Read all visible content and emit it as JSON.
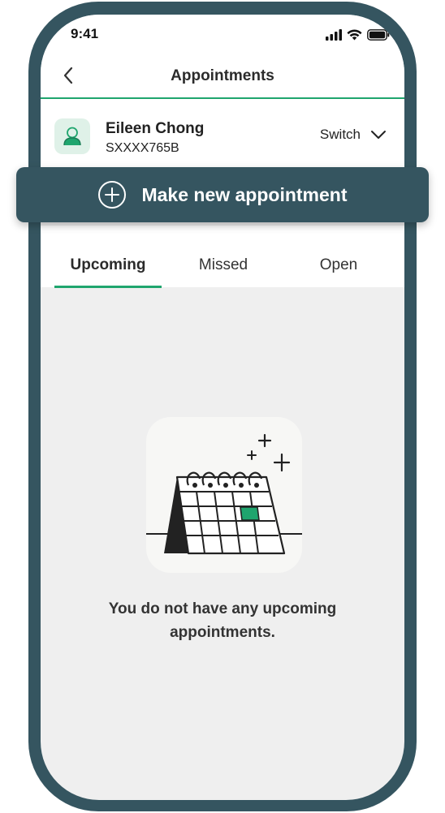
{
  "status_bar": {
    "time": "9:41"
  },
  "header": {
    "title": "Appointments"
  },
  "profile": {
    "name": "Eileen Chong",
    "id": "SXXXX765B",
    "switch_label": "Switch"
  },
  "actions": {
    "make_appointment_label": "Make new appointment"
  },
  "tabs": [
    {
      "label": "Upcoming",
      "active": true
    },
    {
      "label": "Missed",
      "active": false
    },
    {
      "label": "Open",
      "active": false
    }
  ],
  "empty_state": {
    "line1": "You do not have any upcoming",
    "line2": "appointments."
  },
  "colors": {
    "frame": "#355560",
    "accent": "#1fa56e",
    "content_bg": "#efefef"
  },
  "icons": [
    "back-arrow-icon",
    "user-icon",
    "chevron-down-icon",
    "plus-circle-icon",
    "calendar-illustration",
    "signal-icon",
    "wifi-icon",
    "battery-icon"
  ]
}
